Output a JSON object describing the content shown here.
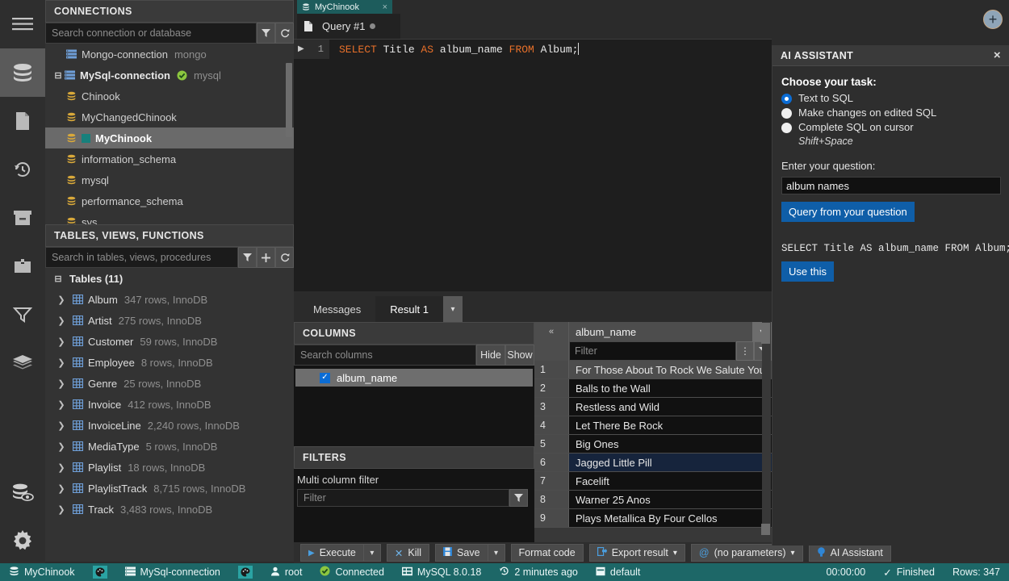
{
  "rail": {
    "items": [
      {
        "name": "menu-icon",
        "glyph": "menu",
        "active": false
      },
      {
        "name": "database-icon",
        "glyph": "database",
        "active": true
      },
      {
        "name": "file-icon",
        "glyph": "file",
        "active": false
      },
      {
        "name": "history-icon",
        "glyph": "history",
        "active": false
      },
      {
        "name": "archive-icon",
        "glyph": "archive",
        "active": false
      },
      {
        "name": "briefcase-icon",
        "glyph": "briefcase",
        "active": false
      },
      {
        "name": "funnel-icon",
        "glyph": "funnel",
        "active": false
      },
      {
        "name": "layers-icon",
        "glyph": "layers",
        "active": false
      },
      {
        "name": "database-view-icon",
        "glyph": "dbview",
        "active": false
      },
      {
        "name": "gear-icon",
        "glyph": "gear",
        "active": false
      }
    ]
  },
  "connections": {
    "title": "CONNECTIONS",
    "search_placeholder": "Search connection or database",
    "search_value": "",
    "tree": [
      {
        "label": "Mongo-connection",
        "suffix": "mongo",
        "level": 1,
        "type": "server",
        "selected": false,
        "bold": false
      },
      {
        "label": "MySql-connection",
        "suffix": "mysql",
        "level": 0,
        "type": "server",
        "selected": false,
        "bold": true,
        "connected": true,
        "expander": "minus"
      },
      {
        "label": "Chinook",
        "suffix": "",
        "level": 2,
        "type": "db",
        "selected": false,
        "bold": false
      },
      {
        "label": "MyChangedChinook",
        "suffix": "",
        "level": 2,
        "type": "db",
        "selected": false,
        "bold": false
      },
      {
        "label": "MyChinook",
        "suffix": "",
        "level": 2,
        "type": "db",
        "selected": true,
        "bold": true,
        "marker": true
      },
      {
        "label": "information_schema",
        "suffix": "",
        "level": 2,
        "type": "db",
        "selected": false,
        "bold": false
      },
      {
        "label": "mysql",
        "suffix": "",
        "level": 2,
        "type": "db",
        "selected": false,
        "bold": false
      },
      {
        "label": "performance_schema",
        "suffix": "",
        "level": 2,
        "type": "db",
        "selected": false,
        "bold": false
      },
      {
        "label": "sys",
        "suffix": "",
        "level": 2,
        "type": "db",
        "selected": false,
        "bold": false
      }
    ]
  },
  "tables": {
    "title": "TABLES, VIEWS, FUNCTIONS",
    "search_placeholder": "Search in tables, views, procedures",
    "search_value": "",
    "group_label": "Tables (11)",
    "items": [
      {
        "name": "Album",
        "meta": "347 rows, InnoDB"
      },
      {
        "name": "Artist",
        "meta": "275 rows, InnoDB"
      },
      {
        "name": "Customer",
        "meta": "59 rows, InnoDB"
      },
      {
        "name": "Employee",
        "meta": "8 rows, InnoDB"
      },
      {
        "name": "Genre",
        "meta": "25 rows, InnoDB"
      },
      {
        "name": "Invoice",
        "meta": "412 rows, InnoDB"
      },
      {
        "name": "InvoiceLine",
        "meta": "2,240 rows, InnoDB"
      },
      {
        "name": "MediaType",
        "meta": "5 rows, InnoDB"
      },
      {
        "name": "Playlist",
        "meta": "18 rows, InnoDB"
      },
      {
        "name": "PlaylistTrack",
        "meta": "8,715 rows, InnoDB"
      },
      {
        "name": "Track",
        "meta": "3,483 rows, InnoDB"
      }
    ]
  },
  "tabs": {
    "db_tab": "MyChinook",
    "db_tab_close": "×",
    "query_tab": "Query #1",
    "add_tab": "+"
  },
  "editor": {
    "line_number": "1",
    "sql_parts": [
      {
        "t": "SELECT",
        "kw": true
      },
      {
        "t": " Title ",
        "kw": false
      },
      {
        "t": "AS",
        "kw": true
      },
      {
        "t": " album_name ",
        "kw": false
      },
      {
        "t": "FROM",
        "kw": true
      },
      {
        "t": " Album;",
        "kw": false
      }
    ]
  },
  "results": {
    "tabs": [
      {
        "label": "Messages",
        "active": false
      },
      {
        "label": "Result 1",
        "active": true
      }
    ],
    "columns_panel": {
      "title": "COLUMNS",
      "search_placeholder": "Search columns",
      "search_value": "",
      "hide_label": "Hide",
      "show_label": "Show",
      "items": [
        {
          "label": "album_name",
          "checked": true
        }
      ]
    },
    "filters_panel": {
      "title": "FILTERS",
      "label": "Multi column filter",
      "filter_placeholder": "Filter",
      "filter_value": ""
    },
    "grid": {
      "collapse_glyph": "«",
      "column_header": "album_name",
      "filter_placeholder": "Filter",
      "filter_value": "",
      "rows": [
        {
          "n": "1",
          "value": "For Those About To Rock We Salute You",
          "state": "first"
        },
        {
          "n": "2",
          "value": "Balls to the Wall",
          "state": ""
        },
        {
          "n": "3",
          "value": "Restless and Wild",
          "state": ""
        },
        {
          "n": "4",
          "value": "Let There Be Rock",
          "state": ""
        },
        {
          "n": "5",
          "value": "Big Ones",
          "state": ""
        },
        {
          "n": "6",
          "value": "Jagged Little Pill",
          "state": "sel"
        },
        {
          "n": "7",
          "value": "Facelift",
          "state": ""
        },
        {
          "n": "8",
          "value": "Warner 25 Anos",
          "state": ""
        },
        {
          "n": "9",
          "value": "Plays Metallica By Four Cellos",
          "state": ""
        }
      ]
    }
  },
  "toolbar": {
    "execute": "Execute",
    "kill": "Kill",
    "save": "Save",
    "format_code": "Format code",
    "export_result": "Export result",
    "parameters": "(no parameters)",
    "ai_assistant": "AI Assistant"
  },
  "statusbar": {
    "database": "MyChinook",
    "connection": "MySql-connection",
    "user": "root",
    "connected": "Connected",
    "server": "MySQL 8.0.18",
    "last_run": "2 minutes ago",
    "schema": "default",
    "timer": "00:00:00",
    "finished": "Finished",
    "rows": "Rows: 347"
  },
  "ai": {
    "title": "AI ASSISTANT",
    "close": "×",
    "heading": "Choose your task:",
    "options": [
      {
        "label": "Text to SQL",
        "selected": true
      },
      {
        "label": "Make changes on edited SQL",
        "selected": false
      },
      {
        "label": "Complete SQL on cursor",
        "selected": false
      }
    ],
    "shortcut_note": "Shift+Space",
    "question_label": "Enter your question:",
    "question_value": "album names",
    "question_placeholder": "",
    "query_button": "Query from your question",
    "generated_sql": "SELECT Title AS album_name FROM Album;",
    "use_button": "Use this"
  },
  "colors": {
    "accent_blue": "#0b6cd4",
    "status_teal": "#1d6767",
    "sql_keyword": "#e8702a",
    "selection": "#16243c"
  }
}
